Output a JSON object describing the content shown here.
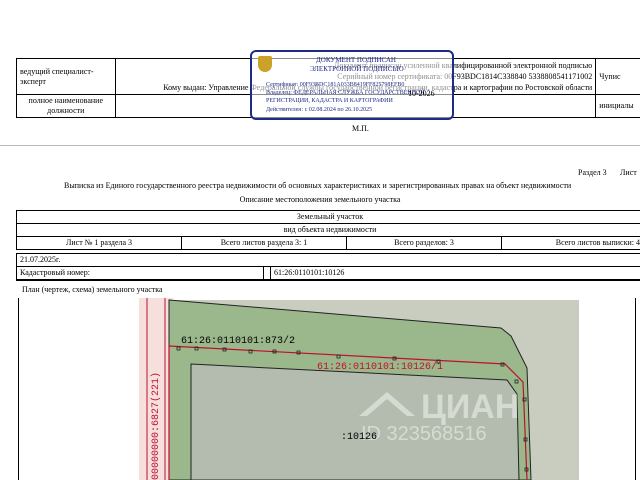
{
  "top_table": {
    "role": "ведущий специалист-эксперт",
    "doc_line1": "Документ подписан усиленной квалифицированной электронной подписью",
    "serial_line": "Серийный номер сертификата: 00F93BDC1814C338840 5338808541171002",
    "issued_line": "Кому выдан: Управление Федеральной службы государственной регистрации, кадастра и картографии по Ростовской области",
    "right_top": "Чупис",
    "full_name_label": "полное наименование должности",
    "initials_label": "инициалы"
  },
  "mp": "М.П.",
  "stamp": {
    "title": "ДОКУМЕНТ ПОДПИСАН",
    "subtitle": "ЭЛЕКТРОННОЙ ПОДПИСЬЮ",
    "cert": "Сертификат: 00F93BDC181A033B8419FF825798EFB0",
    "owner": "Владелец: ФЕДЕРАЛЬНАЯ СЛУЖБА ГОСУДАРСТВЕННОЙ",
    "owner2": "РЕГИСТРАЦИИ, КАДАСТРА И КАРТОГРАФИИ",
    "valid": "Действителен: с 02.08.2024 по 26.10.2025",
    "overlap_date": "10-2026"
  },
  "section": "Раздел 3",
  "sheet": "Лист",
  "heading": "Выписка из Единого государственного реестра недвижимости об основных характеристиках и зарегистрированных правах на объект недвижимости",
  "subheading": "Описание местоположения земельного участка",
  "object_type": "Земельный участок",
  "object_caption": "вид объекта недвижимости",
  "sheet_row": {
    "sheet_no": "Лист № 1 раздела 3",
    "total_sec3": "Всего листов раздела 3: 1",
    "total_sections": "Всего разделов: 3",
    "total_sheets": "Всего листов выписки: 4"
  },
  "date": "21.07.2025г.",
  "cad_label": "Кадастровый номер:",
  "cad_value": "61:26:0110101:10126",
  "plan_label": "План (чертеж, схема) земельного участка",
  "map": {
    "label_top": "61:26:0110101:873/2",
    "label_red": "61:26:0110101:10126/1",
    "label_center": ":10126",
    "label_side": "00000000:6827(221)",
    "watermark": "ЦИАН",
    "watermark_id": "ID 323568516",
    "colors": {
      "parcel": "#9bb88d",
      "inner": "#c9cdc0",
      "field": "#b4bcb0",
      "red": "#c0102b"
    }
  }
}
